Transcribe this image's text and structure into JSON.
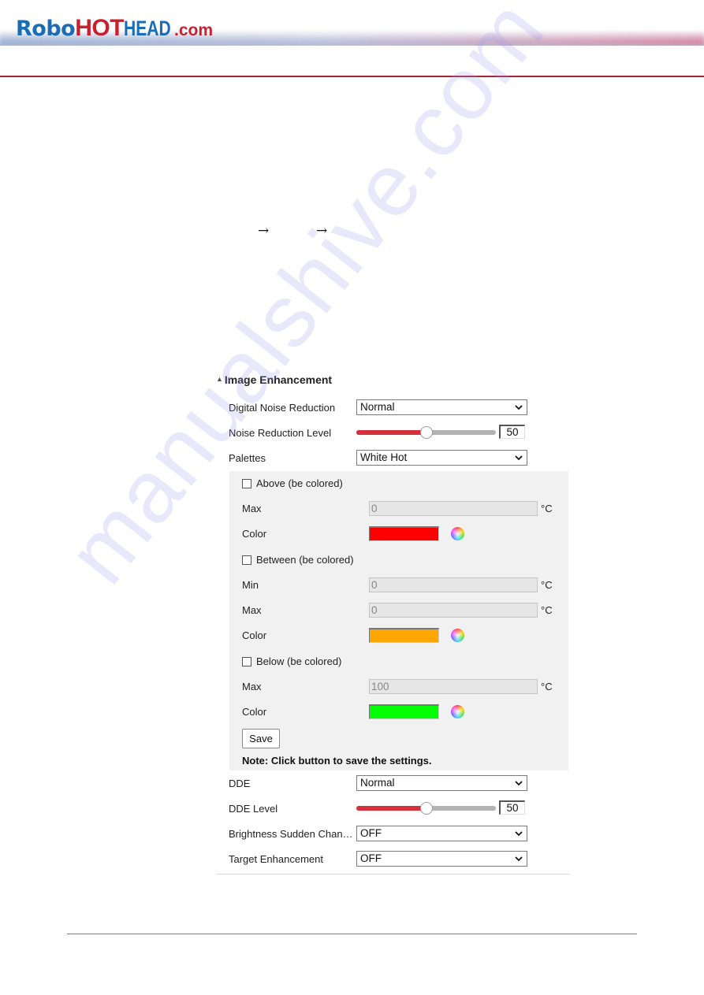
{
  "header": {
    "logo": {
      "robo": "Robo",
      "hot": "HOT",
      "head": "HEAD",
      "com": ".com"
    }
  },
  "breadcrumb": {
    "separators": [
      "→",
      "→"
    ]
  },
  "watermark": "manualshive.com",
  "panel": {
    "section_title": "Image Enhancement",
    "rows": {
      "digital_noise_reduction": {
        "label": "Digital Noise Reduction",
        "value": "Normal"
      },
      "noise_reduction_level": {
        "label": "Noise Reduction Level",
        "value": "50",
        "fraction": 0.5
      },
      "palettes": {
        "label": "Palettes",
        "value": "White Hot"
      }
    },
    "palette_options": {
      "above": {
        "checkbox_label": "Above (be colored)",
        "checked": false,
        "max_label": "Max",
        "max_value": "0",
        "unit": "°C",
        "color_label": "Color",
        "color": "#ff0000"
      },
      "between": {
        "checkbox_label": "Between (be colored)",
        "checked": false,
        "min_label": "Min",
        "min_value": "0",
        "max_label": "Max",
        "max_value": "0",
        "unit": "°C",
        "color_label": "Color",
        "color": "#ffa500"
      },
      "below": {
        "checkbox_label": "Below (be colored)",
        "checked": false,
        "max_label": "Max",
        "max_value": "100",
        "unit": "°C",
        "color_label": "Color",
        "color": "#00ff00"
      },
      "save_label": "Save",
      "note": "Note: Click button to save the settings."
    },
    "rows2": {
      "dde": {
        "label": "DDE",
        "value": "Normal"
      },
      "dde_level": {
        "label": "DDE Level",
        "value": "50",
        "fraction": 0.5
      },
      "brightness_sudden_change": {
        "label": "Brightness Sudden Chan…",
        "value": "OFF"
      },
      "target_enhancement": {
        "label": "Target Enhancement",
        "value": "OFF"
      }
    }
  },
  "colors": {
    "brand_blue": "#1a6db5",
    "brand_red": "#c8202f",
    "slider_fill": "#d4313c"
  }
}
